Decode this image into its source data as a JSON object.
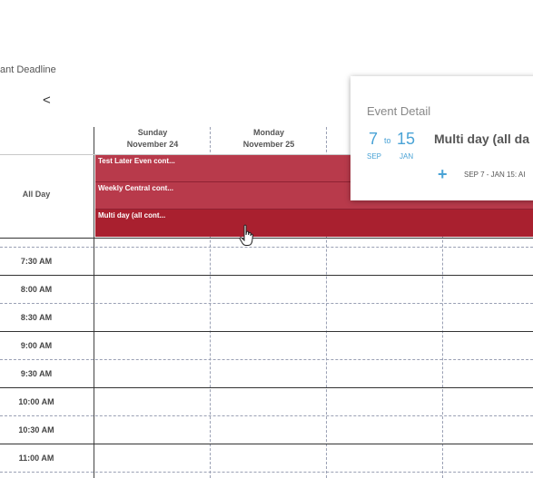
{
  "header": {
    "title_fragment": "ant Deadline",
    "prev_label": "<"
  },
  "columns": [
    {
      "day": "Sunday",
      "date": "November 24"
    },
    {
      "day": "Monday",
      "date": "November 25"
    }
  ],
  "all_day_label": "All Day",
  "events": [
    {
      "title": "Test Later Even cont..."
    },
    {
      "title": "Weekly Central cont..."
    },
    {
      "title": "Multi day (all cont..."
    }
  ],
  "times": [
    "7:30 AM",
    "8:00 AM",
    "8:30 AM",
    "9:00 AM",
    "9:30 AM",
    "10:00 AM",
    "10:30 AM",
    "11:00 AM"
  ],
  "popup": {
    "title": "Event Detail",
    "start_day": "7",
    "to": "to",
    "end_day": "15",
    "start_month": "SEP",
    "end_month": "JAN",
    "event_name": "Multi day (all da",
    "add_icon": "plus-icon",
    "range": "SEP 7 - JAN 15: AI"
  },
  "colors": {
    "event": "#b83a4b",
    "event_active": "#a9202f",
    "accent": "#4aa3d6"
  }
}
